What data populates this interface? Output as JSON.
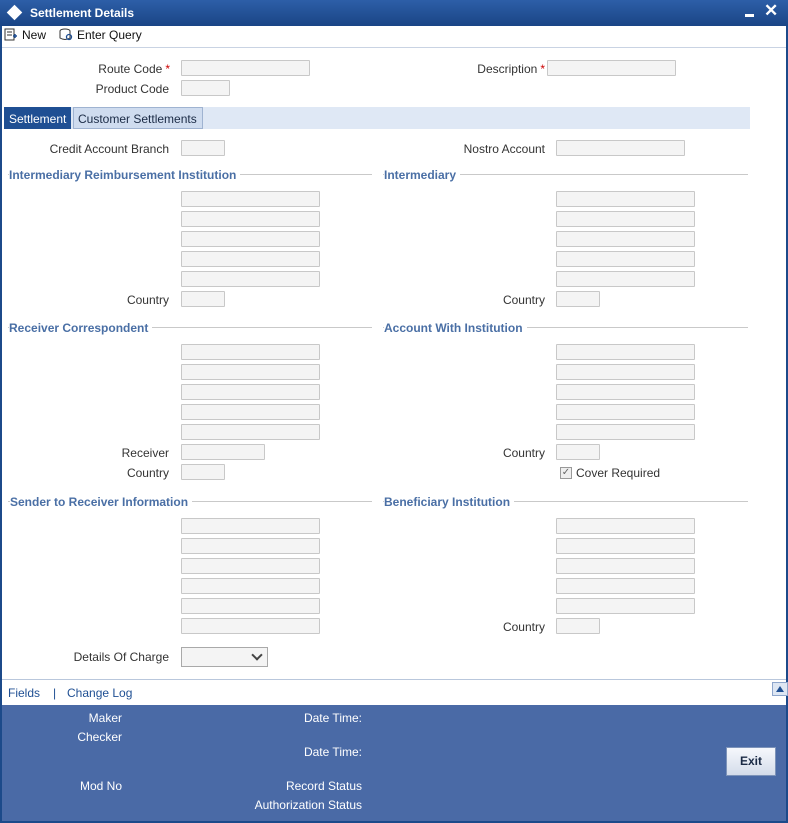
{
  "window": {
    "title": "Settlement Details"
  },
  "toolbar": {
    "new_label": "New",
    "enter_query_label": "Enter Query"
  },
  "header": {
    "route_code_label": "Route Code",
    "product_code_label": "Product Code",
    "description_label": "Description",
    "required_mark": "*"
  },
  "tabs": {
    "settlement": "Settlement",
    "customer_settlements": "Customer Settlements"
  },
  "settlement": {
    "credit_account_branch_label": "Credit Account Branch",
    "nostro_account_label": "Nostro Account",
    "intermediary_reimbursement_title": "Intermediary Reimbursement Institution",
    "intermediary_title": "Intermediary",
    "receiver_correspondent_title": "Receiver Correspondent",
    "account_with_institution_title": "Account With Institution",
    "sender_to_receiver_title": "Sender to Receiver Information",
    "beneficiary_institution_title": "Beneficiary Institution",
    "country_label": "Country",
    "receiver_label": "Receiver",
    "cover_required_label": "Cover Required",
    "cover_required_checked": true,
    "details_of_charge_label": "Details Of Charge",
    "details_of_charge_value": ""
  },
  "links": {
    "fields": "Fields",
    "separator": "|",
    "change_log": "Change Log"
  },
  "footer": {
    "maker_label": "Maker",
    "checker_label": "Checker",
    "date_time_label": "Date Time:",
    "mod_no_label": "Mod No",
    "record_status_label": "Record Status",
    "authorization_status_label": "Authorization Status",
    "exit_label": "Exit"
  },
  "icons": {
    "new": "new-document-icon",
    "enter_query": "query-icon",
    "window": "diamond-icon",
    "minimize": "minimize-icon",
    "close": "close-icon",
    "scroll_up": "scroll-up-icon"
  },
  "colors": {
    "titlebar": "#1a4585",
    "active_tab": "#1f4f93",
    "section_title": "#4a6fa5",
    "footer": "#4a6aa6"
  }
}
